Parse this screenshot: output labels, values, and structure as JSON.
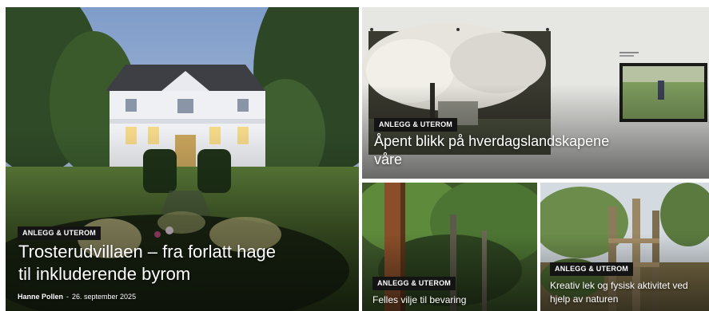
{
  "cards": [
    {
      "category": "ANLEGG & UTEROM",
      "title_line1": "Trosterudvillaen – fra forlatt hage",
      "title_line2": "til inkluderende byrom",
      "author": "Hanne Pollen",
      "date": "26. september 2025"
    },
    {
      "category": "ANLEGG & UTEROM",
      "title_line1": "Åpent blikk på hverdagslandskapene",
      "title_line2": "våre"
    },
    {
      "category": "ANLEGG & UTEROM",
      "title_line1": "Felles vilje til bevaring"
    },
    {
      "category": "ANLEGG & UTEROM",
      "title_line1": "Kreativ lek og fysisk aktivitet ved",
      "title_line2": "hjelp av naturen"
    }
  ],
  "colors": {
    "tag_bg": "#141414",
    "title": "#ffffff"
  }
}
